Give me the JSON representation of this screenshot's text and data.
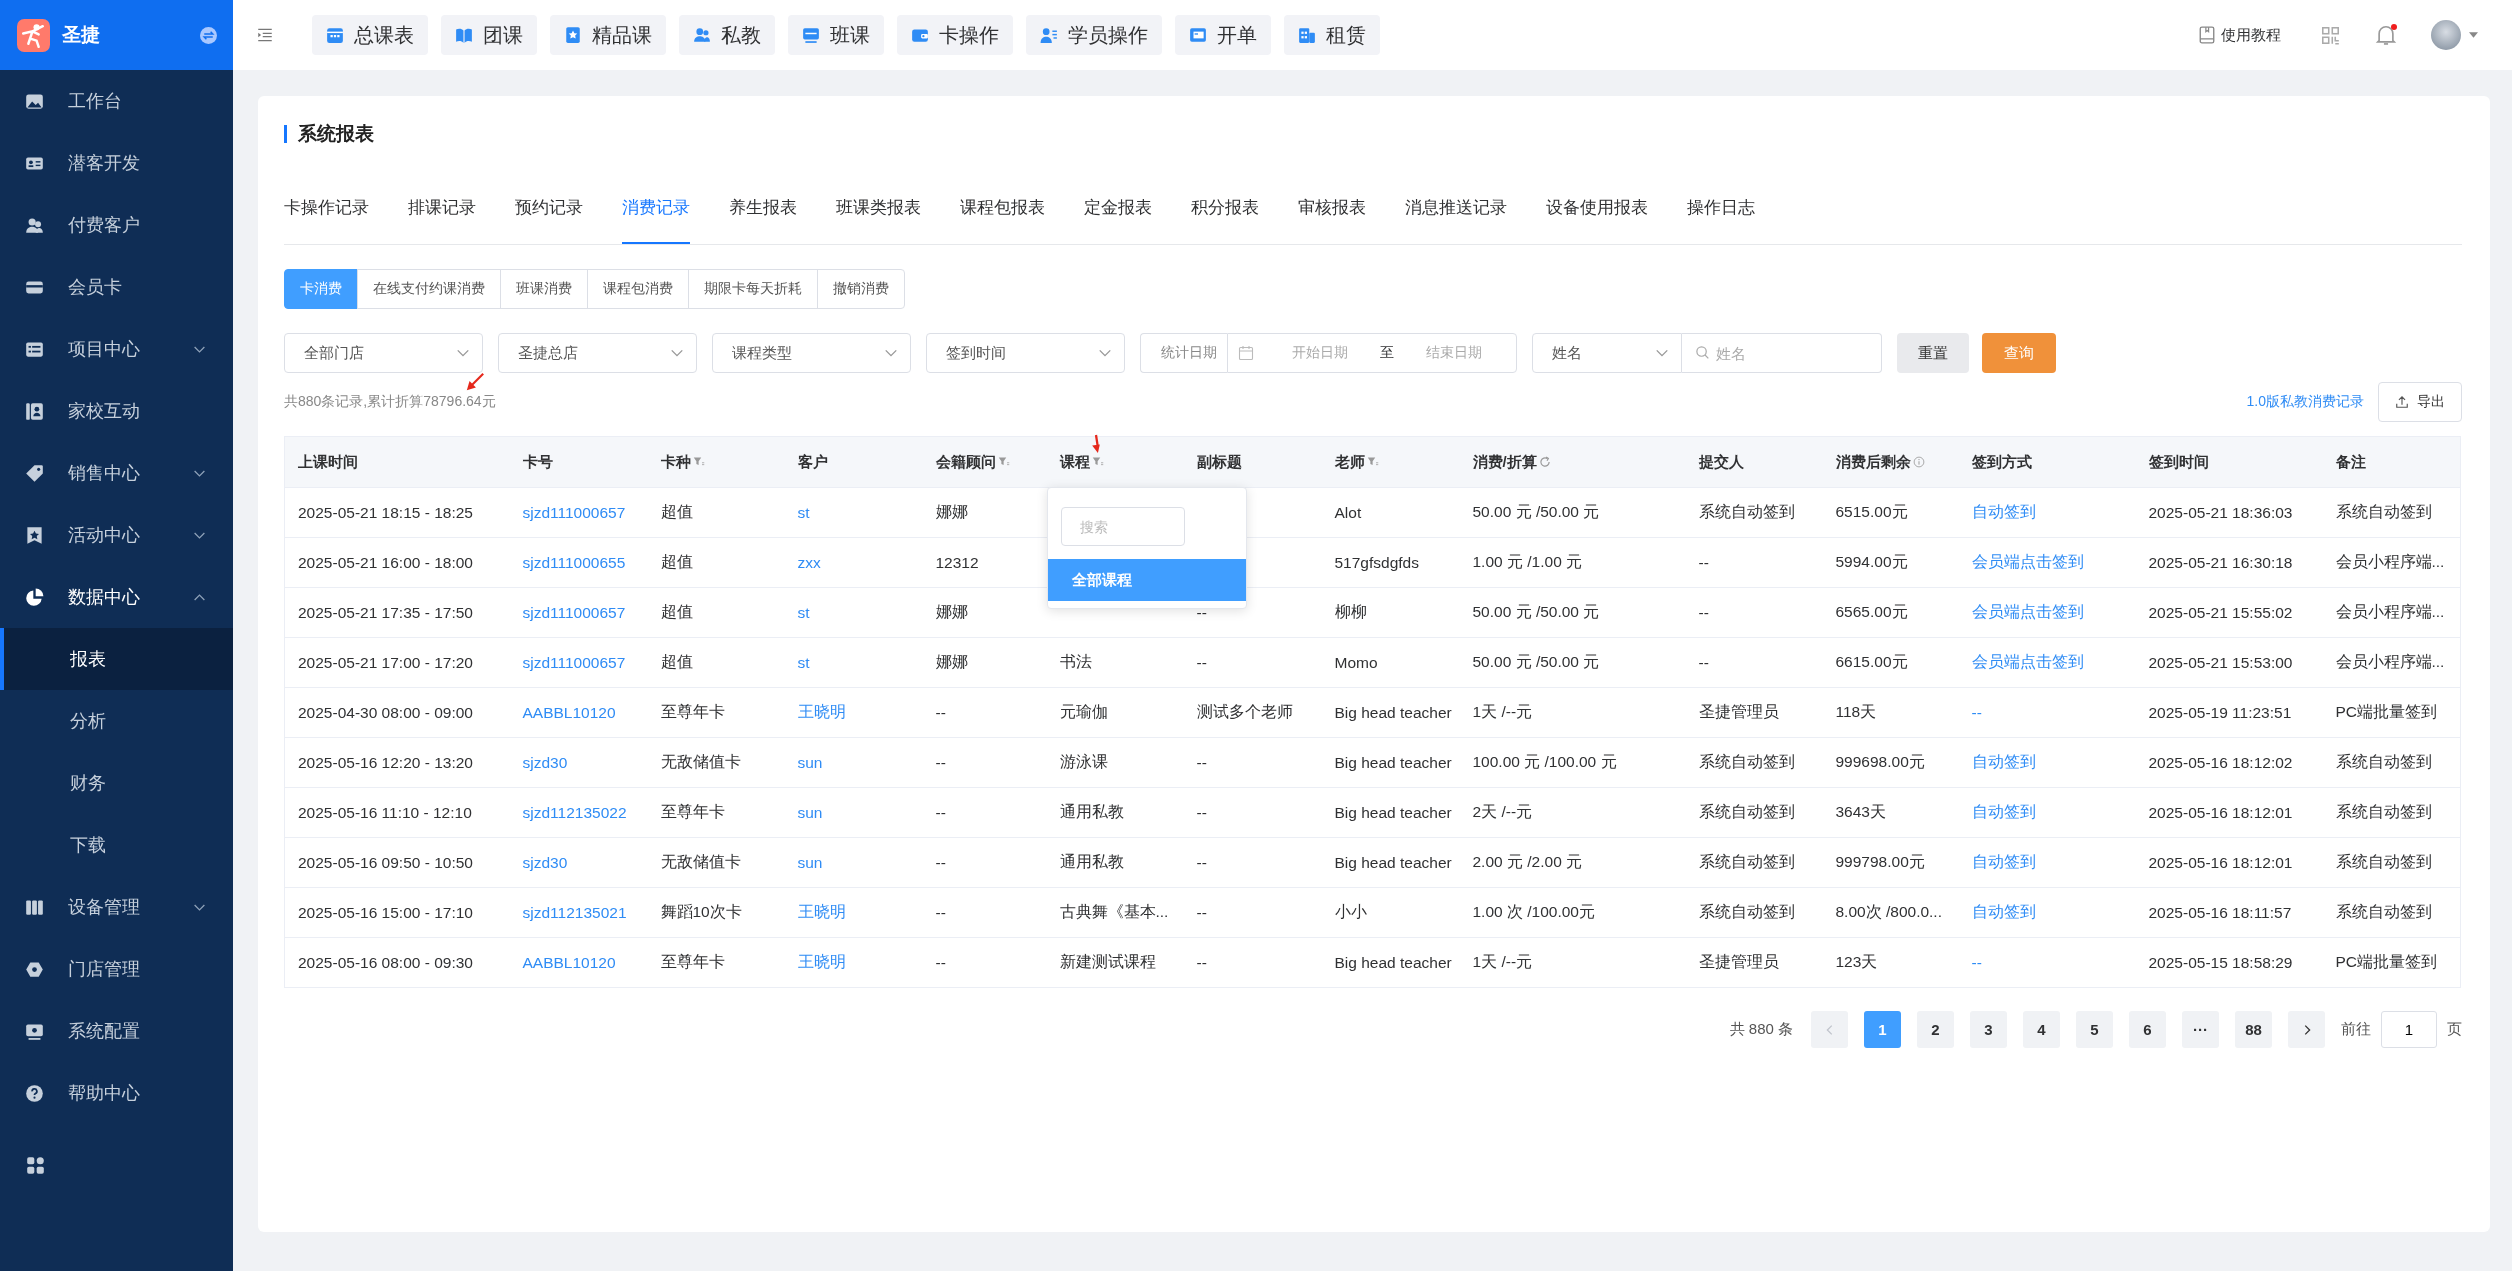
{
  "sidebar": {
    "brand": "圣捷",
    "items": [
      {
        "label": "工作台"
      },
      {
        "label": "潜客开发"
      },
      {
        "label": "付费客户"
      },
      {
        "label": "会员卡"
      },
      {
        "label": "项目中心",
        "expanded": false
      },
      {
        "label": "家校互动"
      },
      {
        "label": "销售中心",
        "expanded": false
      },
      {
        "label": "活动中心",
        "expanded": false
      },
      {
        "label": "数据中心",
        "expanded": true,
        "children": [
          {
            "label": "报表",
            "selected": true
          },
          {
            "label": "分析",
            "selected": false
          },
          {
            "label": "财务",
            "selected": false
          },
          {
            "label": "下载",
            "selected": false
          }
        ]
      },
      {
        "label": "设备管理",
        "expanded": false
      },
      {
        "label": "门店管理"
      },
      {
        "label": "系统配置"
      },
      {
        "label": "帮助中心"
      }
    ]
  },
  "top_nav": [
    "总课表",
    "团课",
    "精品课",
    "私教",
    "班课",
    "卡操作",
    "学员操作",
    "开单",
    "租赁"
  ],
  "top_right": {
    "tutorial": "使用教程",
    "unread": true
  },
  "page": {
    "title": "系统报表",
    "report_tabs": [
      {
        "label": "卡操作记录",
        "selected": false
      },
      {
        "label": "排课记录",
        "selected": false
      },
      {
        "label": "预约记录",
        "selected": false
      },
      {
        "label": "消费记录",
        "selected": true
      },
      {
        "label": "养生报表",
        "selected": false
      },
      {
        "label": "班课类报表",
        "selected": false
      },
      {
        "label": "课程包报表",
        "selected": false
      },
      {
        "label": "定金报表",
        "selected": false
      },
      {
        "label": "积分报表",
        "selected": false
      },
      {
        "label": "审核报表",
        "selected": false
      },
      {
        "label": "消息推送记录",
        "selected": false
      },
      {
        "label": "设备使用报表",
        "selected": false
      },
      {
        "label": "操作日志",
        "selected": false
      }
    ],
    "sub_tabs": [
      {
        "label": "卡消费",
        "selected": true
      },
      {
        "label": "在线支付约课消费",
        "selected": false
      },
      {
        "label": "班课消费",
        "selected": false
      },
      {
        "label": "课程包消费",
        "selected": false
      },
      {
        "label": "期限卡每天折耗",
        "selected": false
      },
      {
        "label": "撤销消费",
        "selected": false
      }
    ],
    "filters": {
      "selects": [
        "全部门店",
        "圣捷总店",
        "课程类型",
        "签到时间"
      ],
      "date_range": {
        "label": "统计日期",
        "start_placeholder": "开始日期",
        "separator": "至",
        "end_placeholder": "结束日期"
      },
      "name_type": "姓名",
      "name_search": {
        "placeholder": "姓名"
      },
      "reset": "重置",
      "query": "查询"
    },
    "summary": "共880条记录,累计折算78796.64元",
    "legacy_link": "1.0版私教消费记录",
    "export": "导出",
    "table": {
      "columns": [
        {
          "label": "上课时间"
        },
        {
          "label": "卡号"
        },
        {
          "label": "卡种"
        },
        {
          "label": "客户"
        },
        {
          "label": "会籍顾问"
        },
        {
          "label": "课程"
        },
        {
          "label": "副标题"
        },
        {
          "label": "老师"
        },
        {
          "label": "消费/折算"
        },
        {
          "label": "提交人"
        },
        {
          "label": "消费后剩余"
        },
        {
          "label": "签到方式"
        },
        {
          "label": "签到时间"
        },
        {
          "label": "备注"
        }
      ],
      "rows": [
        [
          "2025-05-21 18:15 - 18:25",
          "sjzd111000657",
          "超值",
          "st",
          "娜娜",
          null,
          null,
          "Alot",
          "50.00 元 /50.00 元",
          "系统自动签到",
          "6515.00元",
          "自动签到",
          "2025-05-21 18:36:03",
          "系统自动签到"
        ],
        [
          "2025-05-21 16:00 - 18:00",
          "sjzd111000655",
          "超值",
          "zxx",
          "12312",
          null,
          null,
          "517gfsdgfds",
          "1.00 元 /1.00 元",
          "--",
          "5994.00元",
          "会员端点击签到",
          "2025-05-21 16:30:18",
          "会员小程序端..."
        ],
        [
          "2025-05-21 17:35 - 17:50",
          "sjzd111000657",
          "超值",
          "st",
          "娜娜",
          null,
          "--",
          "柳柳",
          "50.00 元 /50.00 元",
          "--",
          "6565.00元",
          "会员端点击签到",
          "2025-05-21 15:55:02",
          "会员小程序端..."
        ],
        [
          "2025-05-21 17:00 - 17:20",
          "sjzd111000657",
          "超值",
          "st",
          "娜娜",
          "书法",
          "--",
          "Momo",
          "50.00 元 /50.00 元",
          "--",
          "6615.00元",
          "会员端点击签到",
          "2025-05-21 15:53:00",
          "会员小程序端..."
        ],
        [
          "2025-04-30 08:00 - 09:00",
          "AABBL10120",
          "至尊年卡",
          "王晓明",
          "--",
          "元瑜伽",
          "测试多个老师",
          "Big head teacher",
          "1天 /--元",
          "圣捷管理员",
          "118天",
          "--",
          "2025-05-19 11:23:51",
          "PC端批量签到"
        ],
        [
          "2025-05-16 12:20 - 13:20",
          "sjzd30",
          "无敌储值卡",
          "sun",
          "--",
          "游泳课",
          "--",
          "Big head teacher",
          "100.00 元 /100.00 元",
          "系统自动签到",
          "999698.00元",
          "自动签到",
          "2025-05-16 18:12:02",
          "系统自动签到"
        ],
        [
          "2025-05-16 11:10 - 12:10",
          "sjzd112135022",
          "至尊年卡",
          "sun",
          "--",
          "通用私教",
          "--",
          "Big head teacher",
          "2天 /--元",
          "系统自动签到",
          "3643天",
          "自动签到",
          "2025-05-16 18:12:01",
          "系统自动签到"
        ],
        [
          "2025-05-16 09:50 - 10:50",
          "sjzd30",
          "无敌储值卡",
          "sun",
          "--",
          "通用私教",
          "--",
          "Big head teacher",
          "2.00 元 /2.00 元",
          "系统自动签到",
          "999798.00元",
          "自动签到",
          "2025-05-16 18:12:01",
          "系统自动签到"
        ],
        [
          "2025-05-16 15:00 - 17:10",
          "sjzd112135021",
          "舞蹈10次卡",
          "王晓明",
          "--",
          "古典舞《基本...",
          "--",
          "小小",
          "1.00 次 /100.00元",
          "系统自动签到",
          "8.00次 /800.0...",
          "自动签到",
          "2025-05-16 18:11:57",
          "系统自动签到"
        ],
        [
          "2025-05-16 08:00 - 09:30",
          "AABBL10120",
          "至尊年卡",
          "王晓明",
          "--",
          "新建测试课程",
          "--",
          "Big head teacher",
          "1天 /--元",
          "圣捷管理员",
          "123天",
          "--",
          "2025-05-15 18:58:29",
          "PC端批量签到"
        ]
      ]
    },
    "course_filter_popup": {
      "search_placeholder": "搜索",
      "items": [
        {
          "label": "全部课程",
          "selected": true
        }
      ]
    },
    "pagination": {
      "total": "共 880 条",
      "prev_disabled": true,
      "pages": [
        {
          "label": "1",
          "selected": true
        },
        {
          "label": "2",
          "selected": false
        },
        {
          "label": "3",
          "selected": false
        },
        {
          "label": "4",
          "selected": false
        },
        {
          "label": "5",
          "selected": false
        },
        {
          "label": "6",
          "selected": false
        },
        {
          "label": "···",
          "selected": false
        },
        {
          "label": "88",
          "selected": false
        }
      ],
      "jump_label": "前往",
      "jump_value": "1",
      "jump_suffix": "页"
    }
  }
}
